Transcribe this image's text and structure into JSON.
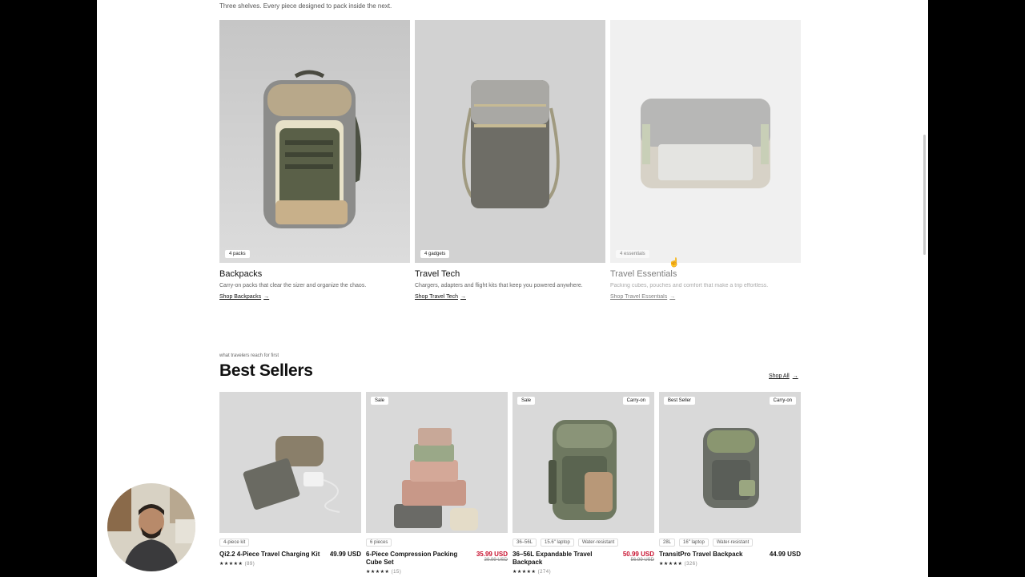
{
  "intro": {
    "subtitle": "Three shelves. Every piece designed to pack inside the next."
  },
  "categories": [
    {
      "pill": "4 packs",
      "title": "Backpacks",
      "desc": "Carry-on packs that clear the sizer and organize the chaos.",
      "link": "Shop Backpacks"
    },
    {
      "pill": "4 gadgets",
      "title": "Travel Tech",
      "desc": "Chargers, adapters and flight kits that keep you powered anywhere.",
      "link": "Shop Travel Tech"
    },
    {
      "pill": "4 essentials",
      "title": "Travel Essentials",
      "desc": "Packing cubes, pouches and comfort that make a trip effortless.",
      "link": "Shop Travel Essentials"
    }
  ],
  "bestsellers": {
    "eyebrow": "what travelers reach for first",
    "title": "Best Sellers",
    "shop_all": "Shop All",
    "products": [
      {
        "badge_left": "",
        "badge_right": "",
        "tags": [
          "4-piece kit"
        ],
        "name": "Qi2.2 4-Piece Travel Charging Kit",
        "price": "49.99 USD",
        "was": "",
        "reviews": "(89)"
      },
      {
        "badge_left": "Sale",
        "badge_right": "",
        "tags": [
          "6 pieces"
        ],
        "name": "6-Piece Compression Packing Cube Set",
        "price": "35.99 USD",
        "was": "39.99 USD",
        "reviews": "(15)"
      },
      {
        "badge_left": "Sale",
        "badge_right": "Carry-on",
        "tags": [
          "36–56L",
          "15.6\" laptop",
          "Water-resistant"
        ],
        "name": "36–56L Expandable Travel Backpack",
        "price": "50.99 USD",
        "was": "56.99 USD",
        "reviews": "(274)"
      },
      {
        "badge_left": "Best Seller",
        "badge_right": "Carry-on",
        "tags": [
          "28L",
          "16\" laptop",
          "Water-resistant"
        ],
        "name": "TransitPro Travel Backpack",
        "price": "44.99 USD",
        "was": "",
        "reviews": "(326)"
      }
    ]
  },
  "colors": {
    "sale": "#c8102e",
    "image_bg": "#d8d8d8",
    "page_bg": "#ffffff",
    "frame_bg": "#000000"
  },
  "icons": [
    "arrow-right-icon",
    "star-icon",
    "hand-cursor-icon"
  ]
}
